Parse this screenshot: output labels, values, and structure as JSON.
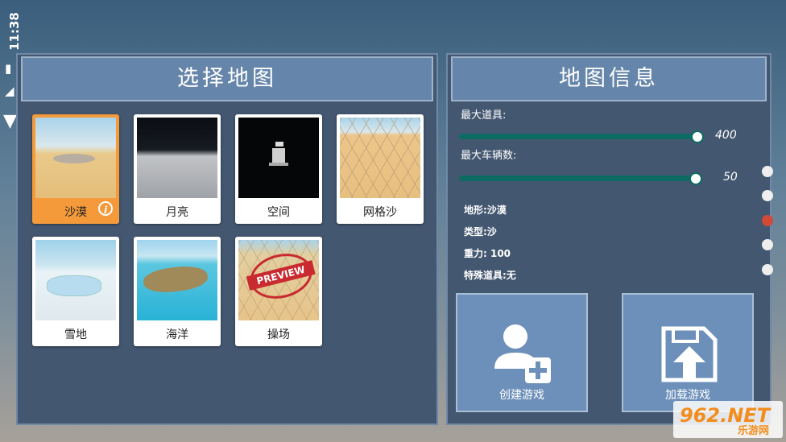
{
  "status_bar": {
    "time": "11:38"
  },
  "left_panel": {
    "title": "选择地图",
    "maps": [
      {
        "label": "沙漠",
        "selected": true
      },
      {
        "label": "月亮",
        "selected": false
      },
      {
        "label": "空间",
        "selected": false
      },
      {
        "label": "网格沙",
        "selected": false
      },
      {
        "label": "雪地",
        "selected": false
      },
      {
        "label": "海洋",
        "selected": false
      },
      {
        "label": "操场",
        "selected": false,
        "stamp": "PREVIEW"
      }
    ],
    "info_icon_glyph": "i"
  },
  "right_panel": {
    "title": "地图信息",
    "max_items_label": "最大道具:",
    "max_items_value": "400",
    "max_vehicles_label": "最大车辆数:",
    "max_vehicles_value": "50",
    "terrain": "地形:沙漠",
    "type": "类型:沙",
    "gravity": "重力: 100",
    "special_items": "特殊道具:无",
    "create_game": "创建游戏",
    "load_game": "加载游戏"
  },
  "page_dots": {
    "count": 5,
    "active_index": 2
  },
  "watermark": {
    "logo": "962.NET",
    "line1": ".NET",
    "line2": "乐游网"
  },
  "colors": {
    "panel_bg": "#435770",
    "header_bg": "#6585aa",
    "selected_card": "#f49a3a",
    "slider": "#0c6b62",
    "active_dot": "#d24a35"
  }
}
